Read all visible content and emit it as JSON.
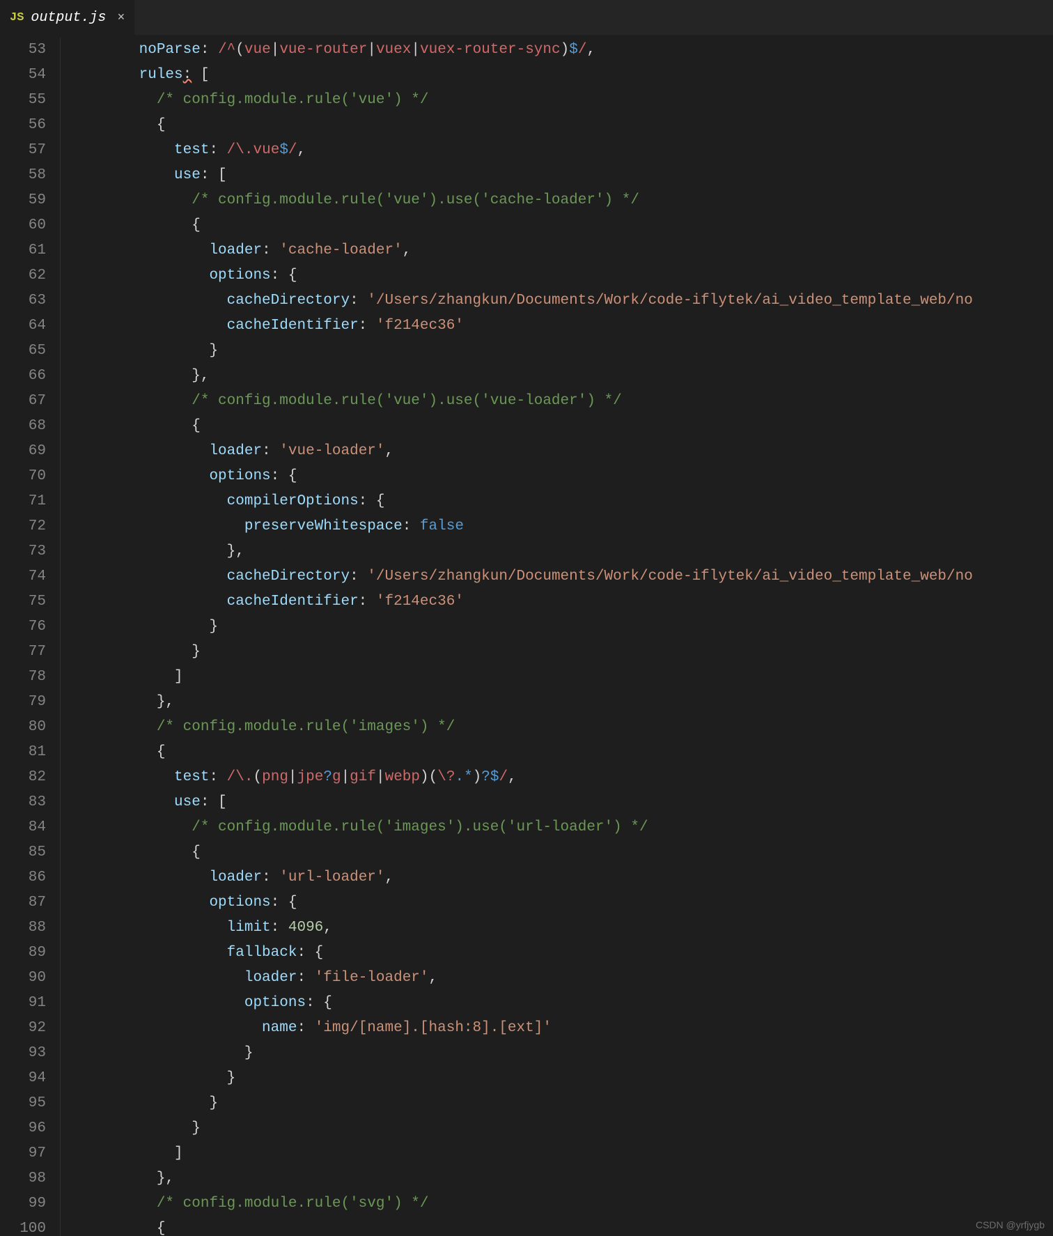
{
  "tab": {
    "icon_label": "JS",
    "filename": "output.js",
    "close_glyph": "×"
  },
  "watermark": "CSDN @yrfjygb",
  "gutter": {
    "start": 53,
    "end": 100
  },
  "code_lines": [
    [
      [
        "prop",
        "noParse"
      ],
      [
        "punc",
        ": "
      ],
      [
        "regex",
        "/"
      ],
      [
        "regex",
        "^"
      ],
      [
        "punc",
        "("
      ],
      [
        "regex",
        "vue"
      ],
      [
        "punc",
        "|"
      ],
      [
        "regex",
        "vue-router"
      ],
      [
        "punc",
        "|"
      ],
      [
        "regex",
        "vuex"
      ],
      [
        "punc",
        "|"
      ],
      [
        "regex",
        "vuex-router-sync"
      ],
      [
        "punc",
        ")"
      ],
      [
        "regex-b",
        "$"
      ],
      [
        "regex",
        "/"
      ],
      [
        "punc",
        ","
      ]
    ],
    [
      [
        "prop",
        "rules"
      ],
      [
        "punc-squiggle",
        ":"
      ],
      [
        "punc",
        " ["
      ]
    ],
    [
      [
        "indent",
        1
      ],
      [
        "comment",
        "/* config.module.rule('vue') */"
      ]
    ],
    [
      [
        "indent",
        1
      ],
      [
        "punc",
        "{"
      ]
    ],
    [
      [
        "indent",
        2
      ],
      [
        "prop",
        "test"
      ],
      [
        "punc",
        ": "
      ],
      [
        "regex",
        "/"
      ],
      [
        "regex",
        "\\."
      ],
      [
        "regex",
        "vue"
      ],
      [
        "regex-b",
        "$"
      ],
      [
        "regex",
        "/"
      ],
      [
        "punc",
        ","
      ]
    ],
    [
      [
        "indent",
        2
      ],
      [
        "prop",
        "use"
      ],
      [
        "punc",
        ": ["
      ]
    ],
    [
      [
        "indent",
        3
      ],
      [
        "comment",
        "/* config.module.rule('vue').use('cache-loader') */"
      ]
    ],
    [
      [
        "indent",
        3
      ],
      [
        "punc",
        "{"
      ]
    ],
    [
      [
        "indent",
        4
      ],
      [
        "prop",
        "loader"
      ],
      [
        "punc",
        ": "
      ],
      [
        "string",
        "'cache-loader'"
      ],
      [
        "punc",
        ","
      ]
    ],
    [
      [
        "indent",
        4
      ],
      [
        "prop",
        "options"
      ],
      [
        "punc",
        ": {"
      ]
    ],
    [
      [
        "indent",
        5
      ],
      [
        "prop",
        "cacheDirectory"
      ],
      [
        "punc",
        ": "
      ],
      [
        "string",
        "'/Users/zhangkun/Documents/Work/code-iflytek/ai_video_template_web/no"
      ]
    ],
    [
      [
        "indent",
        5
      ],
      [
        "prop",
        "cacheIdentifier"
      ],
      [
        "punc",
        ": "
      ],
      [
        "string",
        "'f214ec36'"
      ]
    ],
    [
      [
        "indent",
        4
      ],
      [
        "punc",
        "}"
      ]
    ],
    [
      [
        "indent",
        3
      ],
      [
        "punc",
        "},"
      ]
    ],
    [
      [
        "indent",
        3
      ],
      [
        "comment",
        "/* config.module.rule('vue').use('vue-loader') */"
      ]
    ],
    [
      [
        "indent",
        3
      ],
      [
        "punc",
        "{"
      ]
    ],
    [
      [
        "indent",
        4
      ],
      [
        "prop",
        "loader"
      ],
      [
        "punc",
        ": "
      ],
      [
        "string",
        "'vue-loader'"
      ],
      [
        "punc",
        ","
      ]
    ],
    [
      [
        "indent",
        4
      ],
      [
        "prop",
        "options"
      ],
      [
        "punc",
        ": {"
      ]
    ],
    [
      [
        "indent",
        5
      ],
      [
        "prop",
        "compilerOptions"
      ],
      [
        "punc",
        ": {"
      ]
    ],
    [
      [
        "indent",
        6
      ],
      [
        "prop",
        "preserveWhitespace"
      ],
      [
        "punc",
        ": "
      ],
      [
        "bool",
        "false"
      ]
    ],
    [
      [
        "indent",
        5
      ],
      [
        "punc",
        "},"
      ]
    ],
    [
      [
        "indent",
        5
      ],
      [
        "prop",
        "cacheDirectory"
      ],
      [
        "punc",
        ": "
      ],
      [
        "string",
        "'/Users/zhangkun/Documents/Work/code-iflytek/ai_video_template_web/no"
      ]
    ],
    [
      [
        "indent",
        5
      ],
      [
        "prop",
        "cacheIdentifier"
      ],
      [
        "punc",
        ": "
      ],
      [
        "string",
        "'f214ec36'"
      ]
    ],
    [
      [
        "indent",
        4
      ],
      [
        "punc",
        "}"
      ]
    ],
    [
      [
        "indent",
        3
      ],
      [
        "punc",
        "}"
      ]
    ],
    [
      [
        "indent",
        2
      ],
      [
        "punc",
        "]"
      ]
    ],
    [
      [
        "indent",
        1
      ],
      [
        "punc",
        "},"
      ]
    ],
    [
      [
        "indent",
        1
      ],
      [
        "comment",
        "/* config.module.rule('images') */"
      ]
    ],
    [
      [
        "indent",
        1
      ],
      [
        "punc",
        "{"
      ]
    ],
    [
      [
        "indent",
        2
      ],
      [
        "prop",
        "test"
      ],
      [
        "punc",
        ": "
      ],
      [
        "regex",
        "/"
      ],
      [
        "regex",
        "\\."
      ],
      [
        "punc",
        "("
      ],
      [
        "regex",
        "png"
      ],
      [
        "punc",
        "|"
      ],
      [
        "regex",
        "jpe"
      ],
      [
        "regex-b",
        "?"
      ],
      [
        "regex",
        "g"
      ],
      [
        "punc",
        "|"
      ],
      [
        "regex",
        "gif"
      ],
      [
        "punc",
        "|"
      ],
      [
        "regex",
        "webp"
      ],
      [
        "punc",
        ")("
      ],
      [
        "regex",
        "\\?"
      ],
      [
        "regex-b",
        "."
      ],
      [
        "regex-b",
        "*"
      ],
      [
        "punc",
        ")"
      ],
      [
        "regex-b",
        "?"
      ],
      [
        "regex-b",
        "$"
      ],
      [
        "regex",
        "/"
      ],
      [
        "punc",
        ","
      ]
    ],
    [
      [
        "indent",
        2
      ],
      [
        "prop",
        "use"
      ],
      [
        "punc",
        ": ["
      ]
    ],
    [
      [
        "indent",
        3
      ],
      [
        "comment",
        "/* config.module.rule('images').use('url-loader') */"
      ]
    ],
    [
      [
        "indent",
        3
      ],
      [
        "punc",
        "{"
      ]
    ],
    [
      [
        "indent",
        4
      ],
      [
        "prop",
        "loader"
      ],
      [
        "punc",
        ": "
      ],
      [
        "string",
        "'url-loader'"
      ],
      [
        "punc",
        ","
      ]
    ],
    [
      [
        "indent",
        4
      ],
      [
        "prop",
        "options"
      ],
      [
        "punc",
        ": {"
      ]
    ],
    [
      [
        "indent",
        5
      ],
      [
        "prop",
        "limit"
      ],
      [
        "punc",
        ": "
      ],
      [
        "num",
        "4096"
      ],
      [
        "punc",
        ","
      ]
    ],
    [
      [
        "indent",
        5
      ],
      [
        "prop",
        "fallback"
      ],
      [
        "punc",
        ": {"
      ]
    ],
    [
      [
        "indent",
        6
      ],
      [
        "prop",
        "loader"
      ],
      [
        "punc",
        ": "
      ],
      [
        "string",
        "'file-loader'"
      ],
      [
        "punc",
        ","
      ]
    ],
    [
      [
        "indent",
        6
      ],
      [
        "prop",
        "options"
      ],
      [
        "punc",
        ": {"
      ]
    ],
    [
      [
        "indent",
        7
      ],
      [
        "prop",
        "name"
      ],
      [
        "punc",
        ": "
      ],
      [
        "string",
        "'img/[name].[hash:8].[ext]'"
      ]
    ],
    [
      [
        "indent",
        6
      ],
      [
        "punc",
        "}"
      ]
    ],
    [
      [
        "indent",
        5
      ],
      [
        "punc",
        "}"
      ]
    ],
    [
      [
        "indent",
        4
      ],
      [
        "punc",
        "}"
      ]
    ],
    [
      [
        "indent",
        3
      ],
      [
        "punc",
        "}"
      ]
    ],
    [
      [
        "indent",
        2
      ],
      [
        "punc",
        "]"
      ]
    ],
    [
      [
        "indent",
        1
      ],
      [
        "punc",
        "},"
      ]
    ],
    [
      [
        "indent",
        1
      ],
      [
        "comment",
        "/* config.module.rule('svg') */"
      ]
    ],
    [
      [
        "indent",
        1
      ],
      [
        "punc",
        "{"
      ]
    ]
  ]
}
